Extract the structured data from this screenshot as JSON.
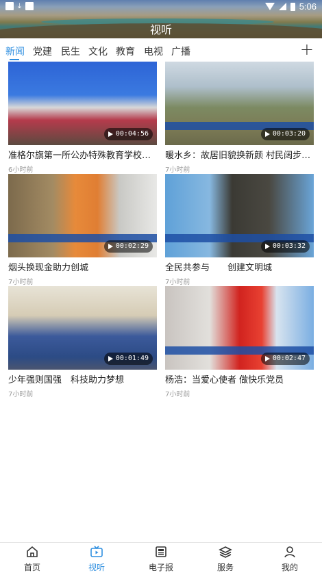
{
  "status_bar": {
    "time": "5:06"
  },
  "header": {
    "title": "视听"
  },
  "tabs": [
    "新闻",
    "党建",
    "民生",
    "文化",
    "教育",
    "电视",
    "广播"
  ],
  "active_tab": "新闻",
  "add_channel_icon": "plus-icon",
  "videos": [
    {
      "title": "准格尔旗第一所公办特殊教育学校开学",
      "time": "6小时前",
      "duration": "00:04:56"
    },
    {
      "title": "暖水乡：故居旧貌换新颜 村民阔步小...",
      "time": "7小时前",
      "duration": "00:03:20"
    },
    {
      "title": "烟头换现金助力创城",
      "time": "7小时前",
      "duration": "00:02:29"
    },
    {
      "title": "全民共参与　　创建文明城",
      "time": "7小时前",
      "duration": "00:03:32"
    },
    {
      "title": "少年强则国强　科技助力梦想",
      "time": "7小时前",
      "duration": "00:01:49"
    },
    {
      "title": "杨浩：当爱心使者 做快乐党员",
      "time": "7小时前",
      "duration": "00:02:47"
    }
  ],
  "bottom_nav": [
    {
      "label": "首页",
      "icon": "home-icon"
    },
    {
      "label": "视听",
      "icon": "tv-icon"
    },
    {
      "label": "电子报",
      "icon": "newspaper-icon"
    },
    {
      "label": "服务",
      "icon": "layers-icon"
    },
    {
      "label": "我的",
      "icon": "user-icon"
    }
  ],
  "colors": {
    "accent": "#2f8fe0",
    "text": "#222222",
    "muted": "#999999"
  }
}
